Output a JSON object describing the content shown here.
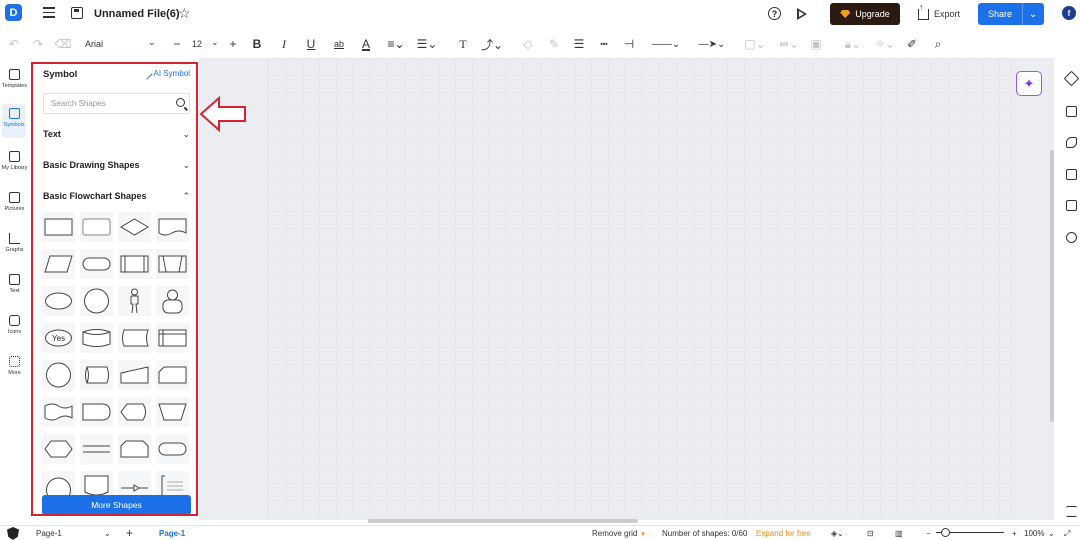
{
  "topbar": {
    "logo": "D",
    "file_title": "Unnamed File(6)",
    "upgrade_label": "Upgrade",
    "export_label": "Export",
    "share_label": "Share",
    "avatar_initial": "f"
  },
  "toolbar": {
    "font_name": "Arial",
    "font_size": "12"
  },
  "rail": {
    "items": [
      {
        "label": "Templates"
      },
      {
        "label": "Symbols"
      },
      {
        "label": "My Library"
      },
      {
        "label": "Pictures"
      },
      {
        "label": "Graphs"
      },
      {
        "label": "Text"
      },
      {
        "label": "Icons"
      },
      {
        "label": "More"
      }
    ]
  },
  "panel": {
    "title": "Symbol",
    "ai_symbol": "AI Symbol",
    "search_placeholder": "Search Shapes",
    "sections": [
      {
        "label": "Text",
        "expanded": false
      },
      {
        "label": "Basic Drawing Shapes",
        "expanded": false
      },
      {
        "label": "Basic Flowchart Shapes",
        "expanded": true
      }
    ],
    "shape_yes_label": "Yes",
    "more_shapes": "More Shapes"
  },
  "statusbar": {
    "page_select": "Page-1",
    "page_tab": "Page-1",
    "remove_grid": "Remove grid",
    "shapes_count": "Number of shapes: 0/60",
    "expand": "Expand for free",
    "zoom": "100%"
  },
  "colors": {
    "accent": "#1c71e8",
    "highlight_red": "#d6232f",
    "upgrade_bg": "#2a1a10",
    "ai_purple": "#8b5cf6"
  }
}
